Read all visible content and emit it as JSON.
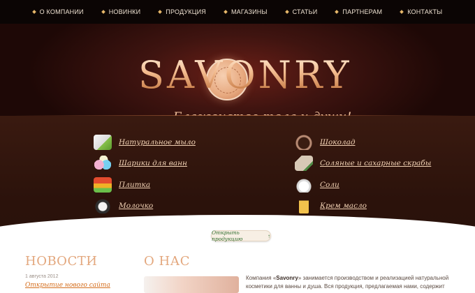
{
  "nav": {
    "items": [
      "О КОМПАНИИ",
      "НОВИНКИ",
      "ПРОДУКЦИЯ",
      "МАГАЗИНЫ",
      "СТАТЬИ",
      "ПАРТНЕРАМ",
      "КОНТАКТЫ"
    ]
  },
  "header": {
    "logo": "SAVONRY",
    "tagline": "Блаженство тела и души!"
  },
  "products": {
    "left": [
      {
        "label": "Натуральное мыло",
        "icon": "soap-icon"
      },
      {
        "label": "Шарики для ванн",
        "icon": "bath-balls-icon"
      },
      {
        "label": "Плитка",
        "icon": "tile-icon"
      },
      {
        "label": "Молочко",
        "icon": "milk-icon"
      }
    ],
    "right": [
      {
        "label": "Шоколад",
        "icon": "chocolate-icon"
      },
      {
        "label": "Соляные и сахарные скрабы",
        "icon": "scrub-icon"
      },
      {
        "label": "Соли",
        "icon": "salts-icon"
      },
      {
        "label": "Крем масло",
        "icon": "cream-oil-icon"
      }
    ],
    "open_button": "Открыть продукцию",
    "open_button_arrow": "↑"
  },
  "news": {
    "title": "НОВОСТИ",
    "date": "1 августа 2012",
    "link": "Открытие нового сайта"
  },
  "about": {
    "title": "О НАС",
    "text_prefix": "Компания «",
    "text_brand": "Savonry",
    "text_suffix": "» занимается производством и реализацией натуральной косметики для ванны и душа. Вся продукция, предлагаемая нами, содержит"
  }
}
